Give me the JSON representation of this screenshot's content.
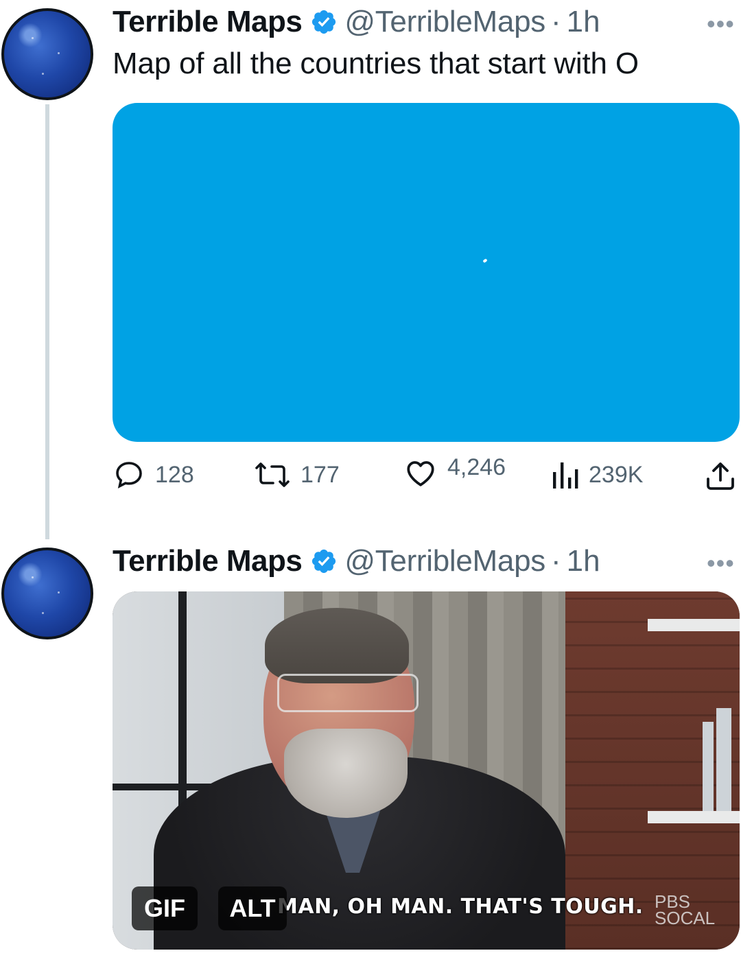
{
  "tweets": [
    {
      "author_name": "Terrible Maps",
      "handle": "@TerribleMaps",
      "separator": "·",
      "time": "1h",
      "more_label": "•••",
      "text": "Map of all the countries that start with O",
      "actions": {
        "replies": "128",
        "retweets": "177",
        "likes": "4,246",
        "views": "239K"
      }
    },
    {
      "author_name": "Terrible Maps",
      "handle": "@TerribleMaps",
      "separator": "·",
      "time": "1h",
      "more_label": "•••",
      "media": {
        "gif_label": "GIF",
        "alt_label": "ALT",
        "caption": "MAN, OH MAN. THAT'S TOUGH.",
        "watermark_line1": "PBS",
        "watermark_line2": "SOCAL"
      }
    }
  ],
  "colors": {
    "map_ocean": "#00a2e4",
    "verified_blue": "#1d9bf0",
    "secondary_text": "#536471",
    "thread_line": "#cfd9de"
  },
  "icons": {
    "reply": "speech-bubble-icon",
    "retweet": "retweet-arrows-icon",
    "like": "heart-icon",
    "views": "bar-chart-icon",
    "share": "upload-arrow-icon",
    "verified": "verified-badge-icon"
  }
}
